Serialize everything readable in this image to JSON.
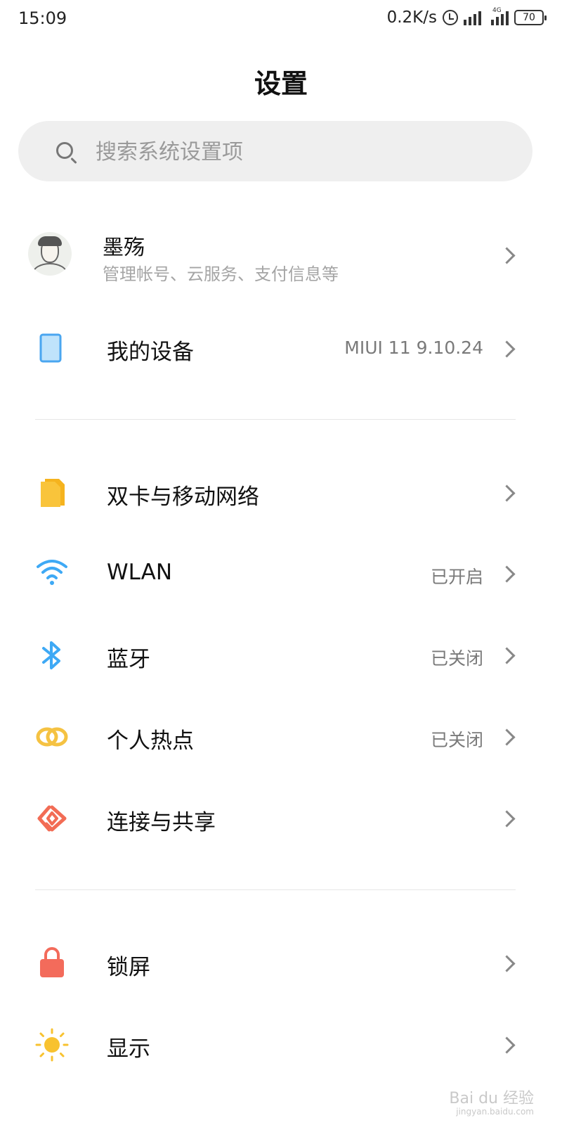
{
  "status_bar": {
    "time": "15:09",
    "network_speed": "0.2K/s",
    "network_type": "4G",
    "battery": "70",
    "icons": [
      "alarm-icon",
      "signal-icon",
      "signal-4g-icon",
      "battery-icon"
    ]
  },
  "header": {
    "title": "设置"
  },
  "search": {
    "placeholder": "搜索系统设置项"
  },
  "account": {
    "name": "墨殇",
    "subtitle": "管理帐号、云服务、支付信息等"
  },
  "device": {
    "label": "我的设备",
    "value": "MIUI 11 9.10.24",
    "icon": "tablet-icon"
  },
  "network_section": [
    {
      "label": "双卡与移动网络",
      "value": "",
      "icon": "sim-card-icon"
    },
    {
      "label": "WLAN",
      "value": "已开启",
      "icon": "wifi-icon"
    },
    {
      "label": "蓝牙",
      "value": "已关闭",
      "icon": "bluetooth-icon"
    },
    {
      "label": "个人热点",
      "value": "已关闭",
      "icon": "hotspot-icon"
    },
    {
      "label": "连接与共享",
      "value": "",
      "icon": "share-icon"
    }
  ],
  "system_section": [
    {
      "label": "锁屏",
      "value": "",
      "icon": "lock-icon"
    },
    {
      "label": "显示",
      "value": "",
      "icon": "sun-icon"
    }
  ],
  "colors": {
    "sim": "#f9c43b",
    "wifi": "#3ea9f5",
    "bluetooth": "#3ea9f5",
    "hotspot": "#f5c242",
    "share": "#f26c55",
    "lock": "#f36b5b",
    "display": "#f8c22f",
    "device": "#4aa6f0"
  },
  "watermark": {
    "brand": "Bai du 经验",
    "url": "jingyan.baidu.com"
  }
}
